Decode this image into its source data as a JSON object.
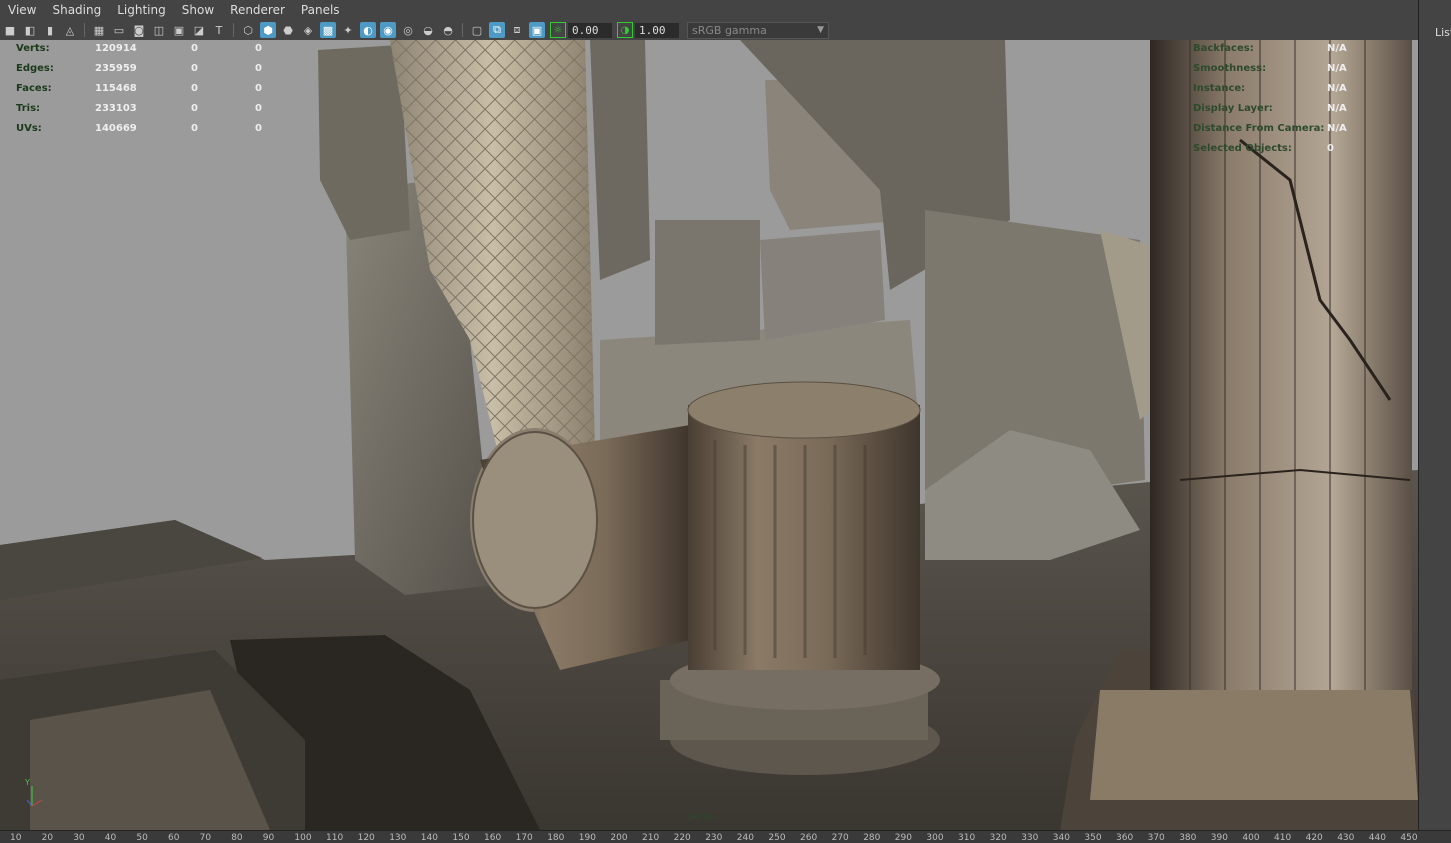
{
  "menubar": {
    "items": [
      "View",
      "Shading",
      "Lighting",
      "Show",
      "Renderer",
      "Panels"
    ]
  },
  "toolbar": {
    "icons": [
      "camera-icon",
      "camera-attr-icon",
      "bookmark-icon",
      "image-plane-icon",
      "grid-icon",
      "film-gate-icon",
      "resolution-gate-icon",
      "gate-mask-icon",
      "field-chart-icon",
      "safe-action-icon",
      "safe-title-icon",
      "wireframe-icon",
      "smooth-shade-icon",
      "shaded-wireframe-icon",
      "default-material-icon",
      "textured-icon",
      "lights-icon",
      "shadows-icon",
      "ambient-occlusion-icon",
      "motion-blur-icon",
      "antialias-icon",
      "depth-of-field-icon",
      "isolate-select-icon",
      "xray-icon",
      "xray-joints-icon",
      "backface-culling-icon",
      "exposure-icon",
      "gamma-icon"
    ],
    "exposure_value": "0.00",
    "gamma_value": "1.00",
    "color_space": "sRGB gamma"
  },
  "hud_left": {
    "rows": [
      {
        "label": "Verts:",
        "value": "120914",
        "c1": "0",
        "c2": "0"
      },
      {
        "label": "Edges:",
        "value": "235959",
        "c1": "0",
        "c2": "0"
      },
      {
        "label": "Faces:",
        "value": "115468",
        "c1": "0",
        "c2": "0"
      },
      {
        "label": "Tris:",
        "value": "233103",
        "c1": "0",
        "c2": "0"
      },
      {
        "label": "UVs:",
        "value": "140669",
        "c1": "0",
        "c2": "0"
      }
    ]
  },
  "hud_right": {
    "rows": [
      {
        "label": "Backfaces:",
        "value": "N/A"
      },
      {
        "label": "Smoothness:",
        "value": "N/A"
      },
      {
        "label": "Instance:",
        "value": "N/A"
      },
      {
        "label": "Display Layer:",
        "value": "N/A"
      },
      {
        "label": "Distance From Camera:",
        "value": "N/A"
      },
      {
        "label": "Selected Objects:",
        "value": "0"
      }
    ]
  },
  "viewport": {
    "camera_label": "persp",
    "axis_y": "Y",
    "axis_x": "X"
  },
  "right_panel": {
    "label": "List"
  },
  "timeline": {
    "ticks": [
      "10",
      "20",
      "30",
      "40",
      "50",
      "60",
      "70",
      "80",
      "90",
      "100",
      "110",
      "120",
      "130",
      "140",
      "150",
      "160",
      "170",
      "180",
      "190",
      "200",
      "210",
      "220",
      "230",
      "240",
      "250",
      "260",
      "270",
      "280",
      "290",
      "300",
      "310",
      "320",
      "330",
      "340",
      "350",
      "360",
      "370",
      "380",
      "390",
      "400",
      "410",
      "420",
      "430",
      "440",
      "450"
    ]
  }
}
